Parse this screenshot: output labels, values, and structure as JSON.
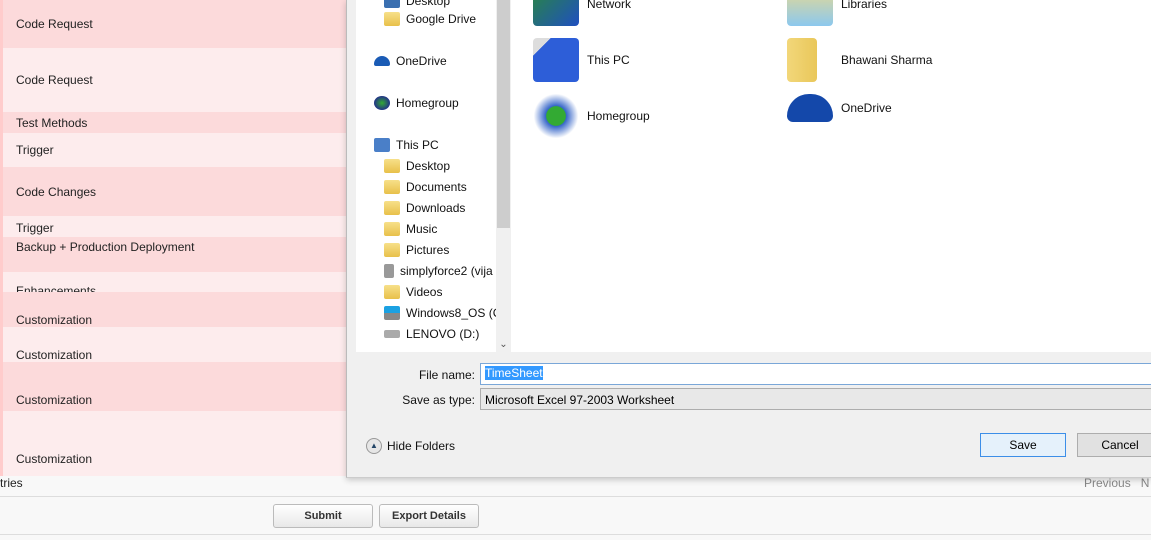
{
  "rows": [
    "Code Request",
    "Code Request",
    "Test Methods",
    "Trigger",
    "Code Changes",
    "Trigger",
    "Backup + Production Deployment",
    "Enhancements",
    "Customization",
    "Customization",
    "Customization",
    "Customization"
  ],
  "footer": {
    "entries": "tries",
    "previous": "Previous",
    "next": "N",
    "submit": "Submit",
    "export": "Export Details"
  },
  "dialog": {
    "nav": [
      "Desktop",
      "Google Drive",
      "OneDrive",
      "Homegroup",
      "This PC",
      "Desktop",
      "Documents",
      "Downloads",
      "Music",
      "Pictures",
      "simplyforce2 (vija",
      "Videos",
      "Windows8_OS (C",
      "LENOVO (D:)"
    ],
    "items": [
      "Network",
      "Libraries",
      "This PC",
      "Bhawani Sharma",
      "Homegroup",
      "OneDrive"
    ],
    "file_name_label": "File name:",
    "file_name": "TimeSheet",
    "save_type_label": "Save as type:",
    "save_type": "Microsoft Excel 97-2003 Worksheet",
    "hide_folders": "Hide Folders",
    "save": "Save",
    "cancel": "Cancel"
  },
  "colors": {
    "row_dark": "#fcdadb",
    "row_light": "#fdeced",
    "accent": "#3399ff"
  }
}
